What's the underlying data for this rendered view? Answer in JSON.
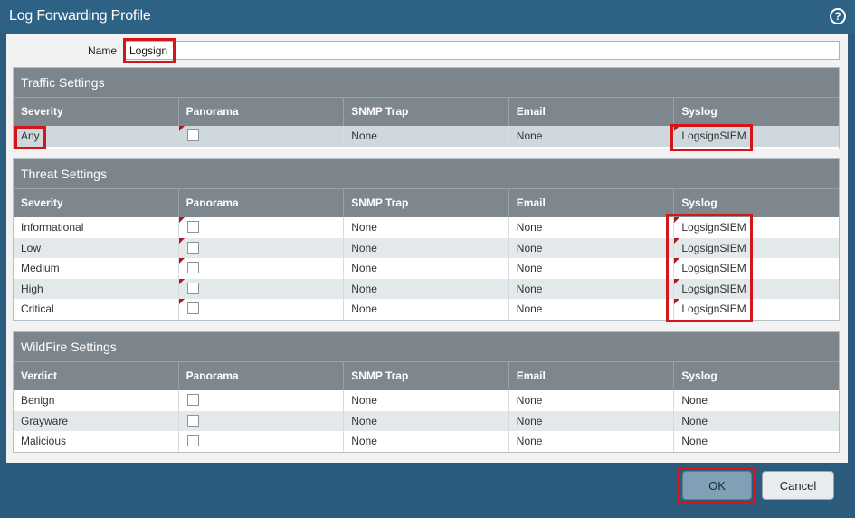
{
  "window": {
    "title": "Log Forwarding Profile",
    "help_icon": "help-circle-icon"
  },
  "name_field": {
    "label": "Name",
    "value": "Logsign"
  },
  "columns": [
    "Panorama",
    "SNMP Trap",
    "Email",
    "Syslog"
  ],
  "traffic": {
    "title": "Traffic Settings",
    "first_col": "Severity",
    "rows": [
      {
        "key": "Any",
        "snmp": "None",
        "email": "None",
        "syslog": "LogsignSIEM"
      }
    ]
  },
  "threat": {
    "title": "Threat Settings",
    "first_col": "Severity",
    "rows": [
      {
        "key": "Informational",
        "snmp": "None",
        "email": "None",
        "syslog": "LogsignSIEM"
      },
      {
        "key": "Low",
        "snmp": "None",
        "email": "None",
        "syslog": "LogsignSIEM"
      },
      {
        "key": "Medium",
        "snmp": "None",
        "email": "None",
        "syslog": "LogsignSIEM"
      },
      {
        "key": "High",
        "snmp": "None",
        "email": "None",
        "syslog": "LogsignSIEM"
      },
      {
        "key": "Critical",
        "snmp": "None",
        "email": "None",
        "syslog": "LogsignSIEM"
      }
    ]
  },
  "wildfire": {
    "title": "WildFire Settings",
    "first_col": "Verdict",
    "rows": [
      {
        "key": "Benign",
        "snmp": "None",
        "email": "None",
        "syslog": "None"
      },
      {
        "key": "Grayware",
        "snmp": "None",
        "email": "None",
        "syslog": "None"
      },
      {
        "key": "Malicious",
        "snmp": "None",
        "email": "None",
        "syslog": "None"
      }
    ]
  },
  "buttons": {
    "ok": "OK",
    "cancel": "Cancel"
  },
  "colors": {
    "highlight": "#d4161b",
    "header": "#7f878e",
    "titlebar": "#2e6284"
  }
}
